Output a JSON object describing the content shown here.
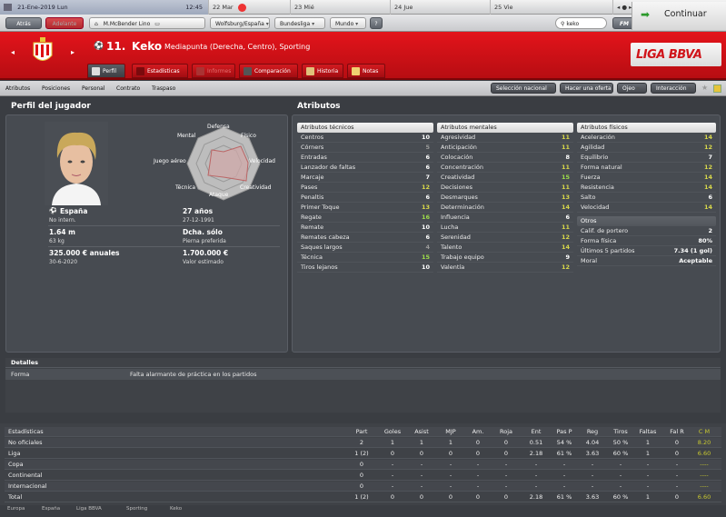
{
  "datebar": {
    "date": "21-Ene-2019 Lun",
    "time": "12:45",
    "days": [
      "22 Mar",
      "23 Mié",
      "24 Jue",
      "25 Vie"
    ],
    "arrows": "◂ ● ▸"
  },
  "nav": {
    "back": "Atrás",
    "forward": "Adelante",
    "manager": "M.McBender Lino",
    "team": "Wolfsburg/España",
    "league": "Bundesliga",
    "world": "Mundo",
    "help": "?",
    "search_value": "keko",
    "fm": "FM",
    "continue": "Continuar"
  },
  "player": {
    "number": "11.",
    "name": "Keko",
    "position": "Mediapunta (Derecha, Centro), Sporting",
    "league_logo": "LIGA BBVA"
  },
  "tabs": [
    "Perfil",
    "Estadísticas",
    "Informes",
    "Comparación",
    "Historia",
    "Notas"
  ],
  "subnav": {
    "items": [
      "Atributos",
      "Posiciones",
      "Personal",
      "Contrato",
      "Traspaso"
    ],
    "buttons": [
      "Selección nacional",
      "Hacer una oferta",
      "Ojeo",
      "Interacción"
    ]
  },
  "profile": {
    "title": "Perfil del jugador",
    "radar_labels": [
      "Defensa",
      "Físico",
      "Velocidad",
      "Creatividad",
      "Ataque",
      "Técnica",
      "Juego aéreo",
      "Mental"
    ],
    "nation": "España",
    "intl": "No intern.",
    "age": "27 años",
    "dob": "27-12-1991",
    "height": "1.64 m",
    "weight": "63 kg",
    "foot": "Dcha. sólo",
    "foot_label": "Pierna preferida",
    "wage": "325.000 € anuales",
    "contract": "30-6-2020",
    "value": "1.700.000 €",
    "value_label": "Valor estimado"
  },
  "attributes": {
    "title": "Atributos",
    "technical_header": "Atributos técnicos",
    "technical": [
      {
        "n": "Centros",
        "v": "10",
        "c": "w"
      },
      {
        "n": "Córners",
        "v": "5",
        "c": "gr"
      },
      {
        "n": "Entradas",
        "v": "6",
        "c": "w"
      },
      {
        "n": "Lanzador de faltas",
        "v": "6",
        "c": "w"
      },
      {
        "n": "Marcaje",
        "v": "7",
        "c": "w"
      },
      {
        "n": "Pases",
        "v": "12",
        "c": "y"
      },
      {
        "n": "Penaltis",
        "v": "6",
        "c": "w"
      },
      {
        "n": "Primer Toque",
        "v": "13",
        "c": "y"
      },
      {
        "n": "Regate",
        "v": "16",
        "c": "g"
      },
      {
        "n": "Remate",
        "v": "10",
        "c": "w"
      },
      {
        "n": "Remates cabeza",
        "v": "6",
        "c": "w"
      },
      {
        "n": "Saques largos",
        "v": "4",
        "c": "gr"
      },
      {
        "n": "Técnica",
        "v": "15",
        "c": "g"
      },
      {
        "n": "Tiros lejanos",
        "v": "10",
        "c": "w"
      }
    ],
    "mental_header": "Atributos mentales",
    "mental": [
      {
        "n": "Agresividad",
        "v": "11",
        "c": "y"
      },
      {
        "n": "Anticipación",
        "v": "11",
        "c": "y"
      },
      {
        "n": "Colocación",
        "v": "8",
        "c": "w"
      },
      {
        "n": "Concentración",
        "v": "11",
        "c": "y"
      },
      {
        "n": "Creatividad",
        "v": "15",
        "c": "g"
      },
      {
        "n": "Decisiones",
        "v": "11",
        "c": "y"
      },
      {
        "n": "Desmarques",
        "v": "13",
        "c": "y"
      },
      {
        "n": "Determinación",
        "v": "14",
        "c": "y"
      },
      {
        "n": "Influencia",
        "v": "6",
        "c": "w"
      },
      {
        "n": "Lucha",
        "v": "11",
        "c": "y"
      },
      {
        "n": "Serenidad",
        "v": "12",
        "c": "y"
      },
      {
        "n": "Talento",
        "v": "14",
        "c": "y"
      },
      {
        "n": "Trabajo equipo",
        "v": "9",
        "c": "w"
      },
      {
        "n": "Valentía",
        "v": "12",
        "c": "y"
      }
    ],
    "physical_header": "Atributos físicos",
    "physical": [
      {
        "n": "Aceleración",
        "v": "14",
        "c": "y"
      },
      {
        "n": "Agilidad",
        "v": "12",
        "c": "y"
      },
      {
        "n": "Equilibrio",
        "v": "7",
        "c": "w"
      },
      {
        "n": "Forma natural",
        "v": "12",
        "c": "y"
      },
      {
        "n": "Fuerza",
        "v": "14",
        "c": "y"
      },
      {
        "n": "Resistencia",
        "v": "14",
        "c": "y"
      },
      {
        "n": "Salto",
        "v": "6",
        "c": "w"
      },
      {
        "n": "Velocidad",
        "v": "14",
        "c": "y"
      }
    ],
    "other_header": "Otros",
    "other": [
      {
        "n": "Calif. de portero",
        "v": "2",
        "c": "w"
      },
      {
        "n": "Forma física",
        "v": "80%",
        "c": "w"
      },
      {
        "n": "Últimos 5 partidos",
        "v": "7.34 (1 gol)",
        "c": "w"
      },
      {
        "n": "Moral",
        "v": "Aceptable",
        "c": "w"
      }
    ]
  },
  "details": {
    "title": "Detalles",
    "label": "Forma",
    "value": "Falta alarmante de práctica en los partidos"
  },
  "stats": {
    "title": "Estadísticas",
    "headers": [
      "Part",
      "Goles",
      "Asist",
      "MJP",
      "Am.",
      "Roja",
      "Ent",
      "Pas P",
      "Reg",
      "Tiros",
      "Faltas",
      "Fal R",
      "C M"
    ],
    "rows": [
      {
        "label": "No oficiales",
        "vals": [
          "2",
          "1",
          "1",
          "1",
          "0",
          "0",
          "0.51",
          "54 %",
          "4.04",
          "50 %",
          "1",
          "0",
          "8.20"
        ]
      },
      {
        "label": "Liga",
        "vals": [
          "1 (2)",
          "0",
          "0",
          "0",
          "0",
          "0",
          "2.18",
          "61 %",
          "3.63",
          "60 %",
          "1",
          "0",
          "6.60"
        ]
      },
      {
        "label": "Copa",
        "vals": [
          "0",
          "-",
          "-",
          "-",
          "-",
          "-",
          "-",
          "-",
          "-",
          "-",
          "-",
          "-",
          "----"
        ]
      },
      {
        "label": "Continental",
        "vals": [
          "0",
          "-",
          "-",
          "-",
          "-",
          "-",
          "-",
          "-",
          "-",
          "-",
          "-",
          "-",
          "----"
        ]
      },
      {
        "label": "Internacional",
        "vals": [
          "0",
          "-",
          "-",
          "-",
          "-",
          "-",
          "-",
          "-",
          "-",
          "-",
          "-",
          "-",
          "----"
        ]
      },
      {
        "label": "Total",
        "vals": [
          "1 (2)",
          "0",
          "0",
          "0",
          "0",
          "0",
          "2.18",
          "61 %",
          "3.63",
          "60 %",
          "1",
          "0",
          "6.60"
        ]
      }
    ]
  },
  "footer": [
    "Europa",
    "España",
    "Liga BBVA",
    "Sporting",
    "Keko"
  ],
  "colors": {
    "accent_red": "#d0141a",
    "good": "#9edc4a",
    "mid": "#d9d94a"
  }
}
